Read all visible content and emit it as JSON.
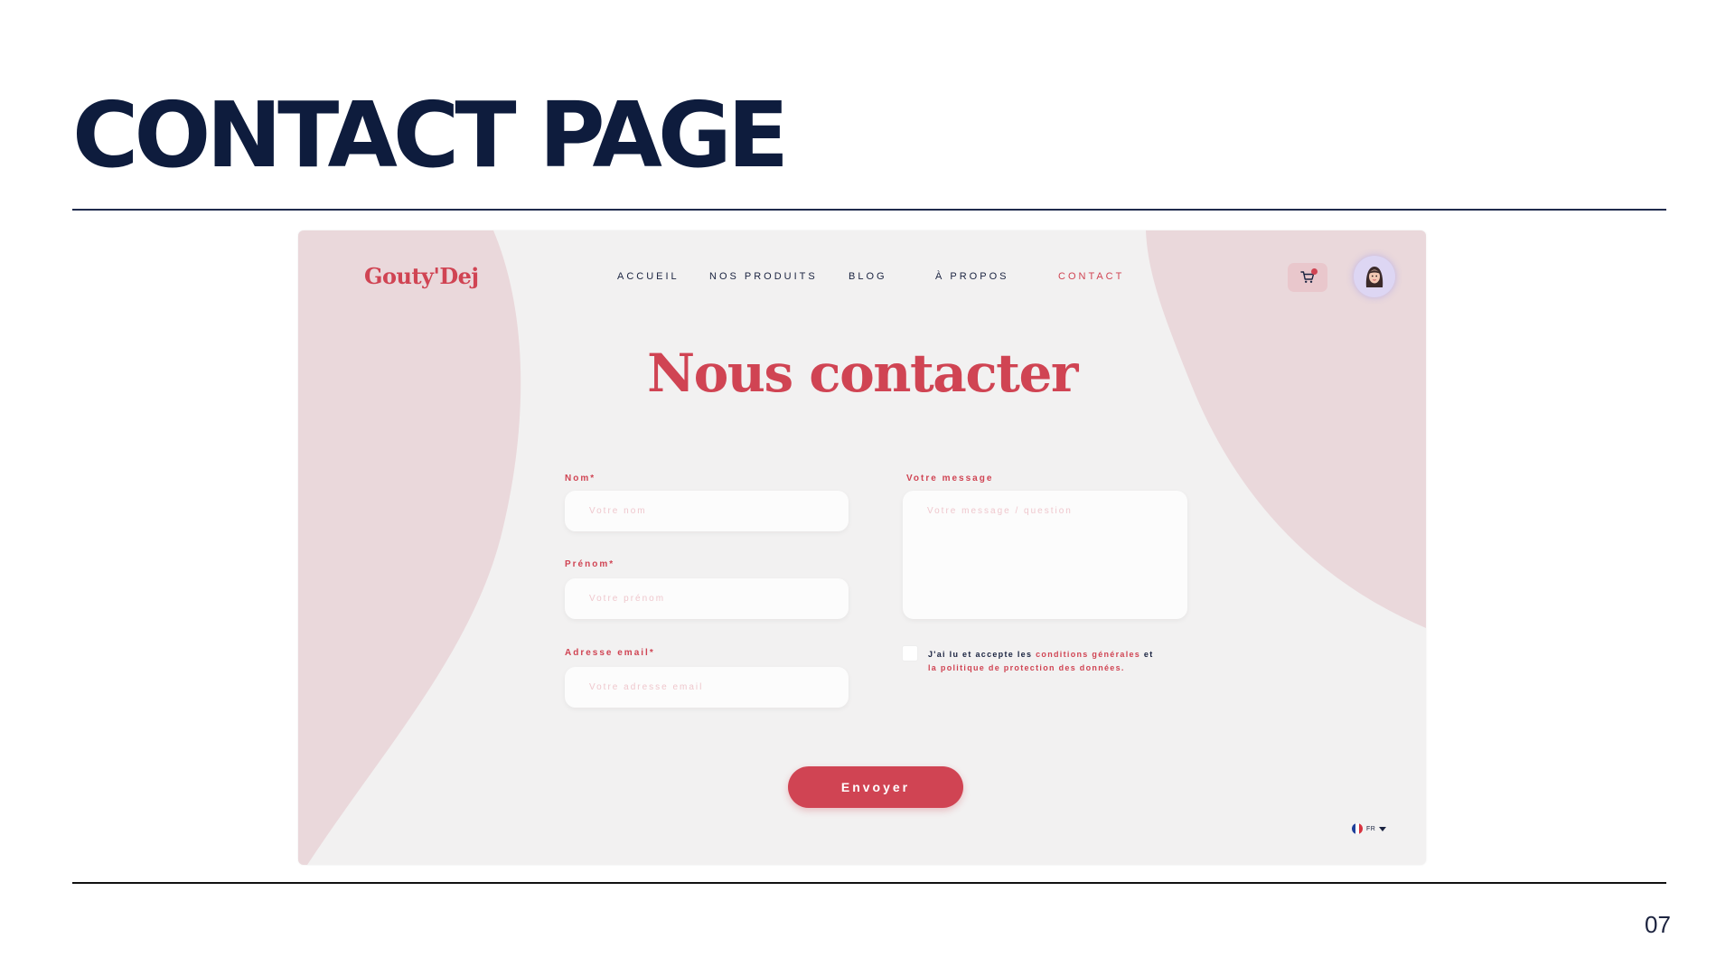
{
  "slide": {
    "title": "CONTACT PAGE",
    "page_number": "07"
  },
  "site": {
    "logo": "Gouty'Dej",
    "nav": [
      {
        "label": "ACCUEIL",
        "active": false
      },
      {
        "label": "NOS PRODUITS",
        "active": false
      },
      {
        "label": "BLOG",
        "active": false
      },
      {
        "label": "À PROPOS",
        "active": false
      },
      {
        "label": "CONTACT",
        "active": true
      }
    ],
    "cart_icon": "cart-icon",
    "avatar_icon": "user-avatar"
  },
  "contact": {
    "heading": "Nous contacter",
    "fields": {
      "nom": {
        "label": "Nom*",
        "placeholder": "Votre nom"
      },
      "prenom": {
        "label": "Prénom*",
        "placeholder": "Votre prénom"
      },
      "email": {
        "label": "Adresse email*",
        "placeholder": "Votre adresse email"
      },
      "message": {
        "label": "Votre message",
        "placeholder": "Votre message / question"
      }
    },
    "consent": {
      "prefix": "J'ai lu et accepte les ",
      "link1": "conditions générales",
      "middle": " et ",
      "link2": "la politique de protection des données."
    },
    "submit_label": "Envoyer"
  },
  "language": {
    "code": "FR"
  },
  "colors": {
    "accent": "#d04453",
    "navy": "#0e1c3d",
    "blob": "#ead8db",
    "background": "#f2f1f1"
  }
}
